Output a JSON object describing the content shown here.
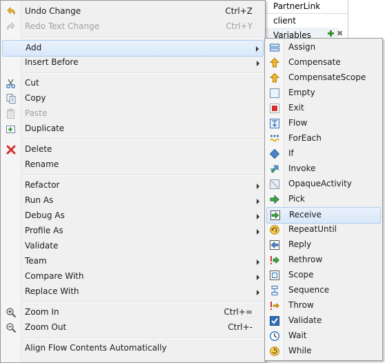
{
  "background": {
    "partnerlink_label": "PartnerLink",
    "client_label": "client",
    "variables_label": "Variables",
    "remove_glyph": "✖"
  },
  "main_menu": {
    "undo": {
      "label": "Undo Change",
      "accel": "Ctrl+Z",
      "icon": "undo-icon"
    },
    "redo": {
      "label": "Redo Text Change",
      "accel": "Ctrl+Y",
      "icon": "redo-icon"
    },
    "add": {
      "label": "Add"
    },
    "insert_before": {
      "label": "Insert Before"
    },
    "cut": {
      "label": "Cut",
      "icon": "scissors-icon"
    },
    "copy": {
      "label": "Copy",
      "icon": "copy-icon"
    },
    "paste": {
      "label": "Paste",
      "icon": "paste-icon"
    },
    "duplicate": {
      "label": "Duplicate",
      "icon": "duplicate-icon"
    },
    "delete": {
      "label": "Delete",
      "icon": "delete-icon",
      "color": "#d32f2f"
    },
    "rename": {
      "label": "Rename"
    },
    "refactor": {
      "label": "Refactor"
    },
    "run_as": {
      "label": "Run As"
    },
    "debug_as": {
      "label": "Debug As"
    },
    "profile_as": {
      "label": "Profile As"
    },
    "validate": {
      "label": "Validate"
    },
    "team": {
      "label": "Team"
    },
    "compare_with": {
      "label": "Compare With"
    },
    "replace_with": {
      "label": "Replace With"
    },
    "zoom_in": {
      "label": "Zoom In",
      "accel": "Ctrl+=",
      "icon": "zoom-in-icon"
    },
    "zoom_out": {
      "label": "Zoom Out",
      "accel": "Ctrl+-",
      "icon": "zoom-out-icon"
    },
    "align": {
      "label": "Align Flow Contents Automatically"
    }
  },
  "sub_menu": {
    "items": [
      {
        "label": "Assign",
        "icon": "assign-icon"
      },
      {
        "label": "Compensate",
        "icon": "compensate-icon"
      },
      {
        "label": "CompensateScope",
        "icon": "compensate-scope-icon"
      },
      {
        "label": "Empty",
        "icon": "empty-icon"
      },
      {
        "label": "Exit",
        "icon": "exit-icon"
      },
      {
        "label": "Flow",
        "icon": "flow-icon"
      },
      {
        "label": "ForEach",
        "icon": "foreach-icon"
      },
      {
        "label": "If",
        "icon": "if-icon"
      },
      {
        "label": "Invoke",
        "icon": "invoke-icon"
      },
      {
        "label": "OpaqueActivity",
        "icon": "opaque-activity-icon"
      },
      {
        "label": "Pick",
        "icon": "pick-icon"
      },
      {
        "label": "Receive",
        "icon": "receive-icon"
      },
      {
        "label": "RepeatUntil",
        "icon": "repeat-until-icon"
      },
      {
        "label": "Reply",
        "icon": "reply-icon"
      },
      {
        "label": "Rethrow",
        "icon": "rethrow-icon"
      },
      {
        "label": "Scope",
        "icon": "scope-icon"
      },
      {
        "label": "Sequence",
        "icon": "sequence-icon"
      },
      {
        "label": "Throw",
        "icon": "throw-icon"
      },
      {
        "label": "Validate",
        "icon": "validate-icon"
      },
      {
        "label": "Wait",
        "icon": "wait-icon"
      },
      {
        "label": "While",
        "icon": "while-icon"
      }
    ],
    "highlighted": "Receive"
  },
  "colors": {
    "menu_bg": "#f0f0f0",
    "highlight": "#d9e8fa",
    "highlight_border": "#aeccf1",
    "disabled_text": "#a0a0a0"
  }
}
